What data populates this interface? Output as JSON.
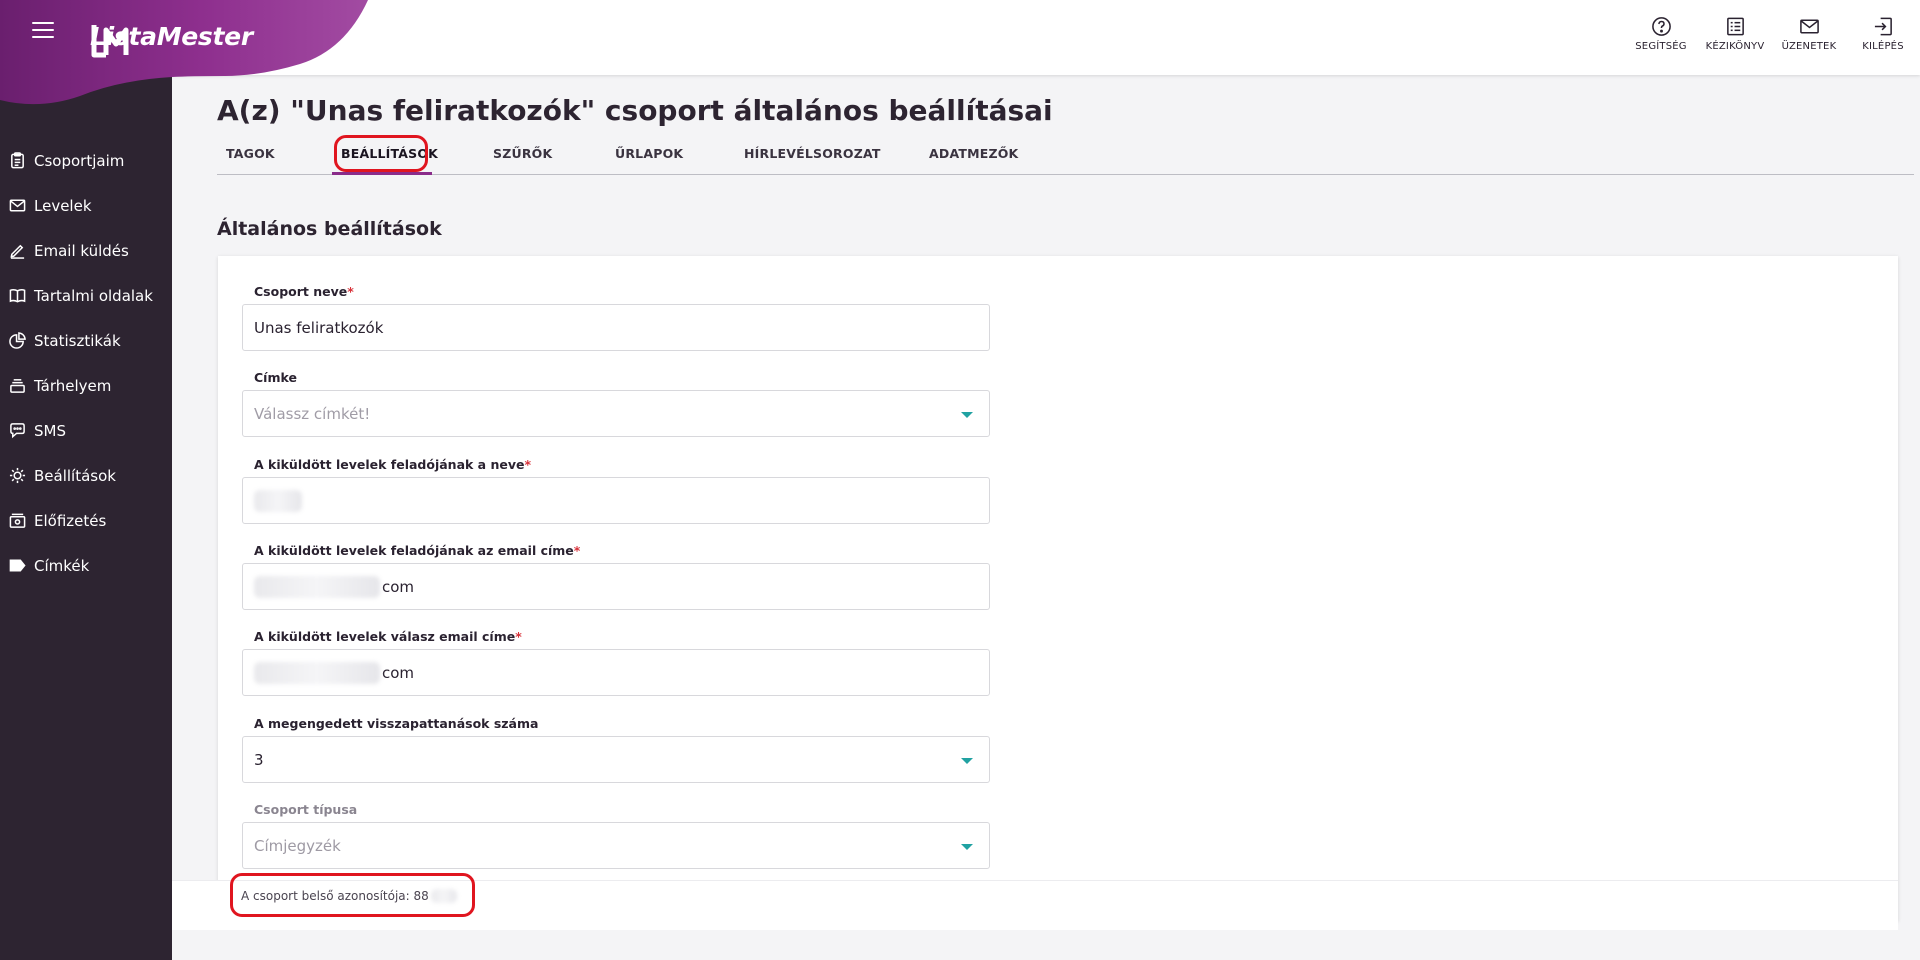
{
  "app": {
    "name": "ListaMester"
  },
  "sidebar": {
    "items": [
      {
        "label": "Csoportjaim",
        "icon": "clipboard-icon"
      },
      {
        "label": "Levelek",
        "icon": "envelope-icon"
      },
      {
        "label": "Email küldés",
        "icon": "pencil-icon"
      },
      {
        "label": "Tartalmi oldalak",
        "icon": "book-icon"
      },
      {
        "label": "Statisztikák",
        "icon": "pie-chart-icon"
      },
      {
        "label": "Tárhelyem",
        "icon": "layers-icon"
      },
      {
        "label": "SMS",
        "icon": "chat-icon"
      },
      {
        "label": "Beállítások",
        "icon": "gear-icon"
      },
      {
        "label": "Előfizetés",
        "icon": "card-icon"
      },
      {
        "label": "Címkék",
        "icon": "tag-icon"
      }
    ]
  },
  "header": {
    "actions": [
      {
        "label": "SEGÍTSÉG",
        "icon": "help-icon"
      },
      {
        "label": "KÉZIKÖNYV",
        "icon": "manual-icon"
      },
      {
        "label": "ÜZENETEK",
        "icon": "mail-icon"
      },
      {
        "label": "KILÉPÉS",
        "icon": "logout-icon"
      }
    ]
  },
  "page": {
    "title": "A(z) \"Unas feliratkozók\" csoport általános beállításai",
    "tabs": [
      {
        "label": "TAGOK"
      },
      {
        "label": "BEÁLLÍTÁSOK",
        "active": true
      },
      {
        "label": "SZŰRŐK"
      },
      {
        "label": "ŰRLAPOK"
      },
      {
        "label": "HÍRLEVÉLSOROZAT"
      },
      {
        "label": "ADATMEZŐK"
      }
    ],
    "section_title": "Általános beállítások"
  },
  "form": {
    "group_name": {
      "label": "Csoport neve",
      "required_mark": "*",
      "value": "Unas feliratkozók"
    },
    "tag": {
      "label": "Címke",
      "placeholder": "Válassz címkét!"
    },
    "sender_name": {
      "label": "A kiküldött levelek feladójának a neve",
      "required_mark": "*",
      "value": ""
    },
    "sender_email": {
      "label": "A kiküldött levelek feladójának az email címe",
      "required_mark": "*",
      "value_suffix": "com"
    },
    "reply_email": {
      "label": "A kiküldött levelek válasz email címe",
      "required_mark": "*",
      "value_suffix": "com"
    },
    "bounces": {
      "label": "A megengedett visszapattanások száma",
      "value": "3"
    },
    "group_type": {
      "label": "Csoport típusa",
      "value": "Címjegyzék"
    }
  },
  "footer": {
    "id_label": "A csoport belső azonosítója: 88"
  },
  "colors": {
    "sidebar": "#2d2431",
    "brand": "#8a2b8a",
    "highlight": "#e0151f",
    "caret": "#21a2a2"
  }
}
